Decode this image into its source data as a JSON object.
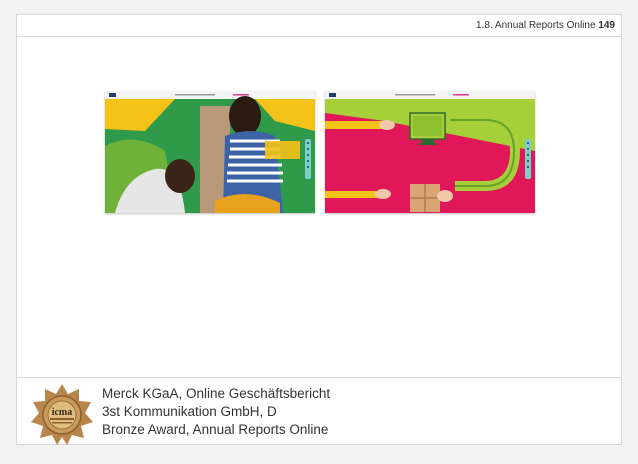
{
  "header": {
    "section": "1.8. Annual Reports Online",
    "page_number": "149"
  },
  "badge": {
    "logo_text": "icma"
  },
  "credits": {
    "line1": "Merck KGaA, Online Geschäftsbericht",
    "line2": "3st Kommunikation GmbH, D",
    "line3": "Bronze Award, Annual Reports Online"
  },
  "colors": {
    "green": "#2e9a4a",
    "magenta": "#e0185a",
    "lime": "#a6cf3a",
    "yellow": "#f5c21a",
    "teal": "#7ccfc8"
  }
}
